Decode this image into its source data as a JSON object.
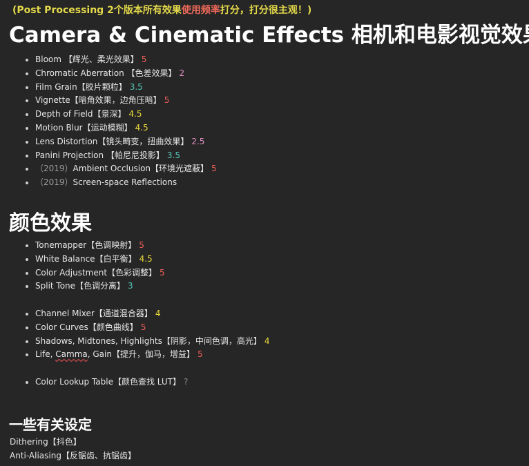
{
  "note": {
    "prefix": "(Post  Processing 2个版本所有效果",
    "highlight": "使用频率",
    "suffix": "打分，打分很主观！)"
  },
  "section1": {
    "title": "Camera & Cinematic Effects 相机和电影视觉效果",
    "items": [
      {
        "prefix": "",
        "text": "Bloom 【辉光、柔光效果】",
        "score": "5",
        "tone": "r"
      },
      {
        "prefix": "",
        "text": "Chromatic Aberration 【色差效果】",
        "score": "2",
        "tone": "p"
      },
      {
        "prefix": "",
        "text": "Film Grain【胶片颗粒】",
        "score": "3.5",
        "tone": "t"
      },
      {
        "prefix": "",
        "text": "Vignette【暗角效果，边角压暗】",
        "score": "5",
        "tone": "r"
      },
      {
        "prefix": "",
        "text": "Depth of Field【景深】",
        "score": "4.5",
        "tone": "y"
      },
      {
        "prefix": "",
        "text": "Motion Blur【运动模糊】",
        "score": "4.5",
        "tone": "y"
      },
      {
        "prefix": "",
        "text": "Lens Distortion【镜头畸变，扭曲效果】",
        "score": "2.5",
        "tone": "p"
      },
      {
        "prefix": "",
        "text": "Panini Projection 【帕尼尼投影】",
        "score": "3.5",
        "tone": "t"
      },
      {
        "prefix": "（2019）",
        "text": "Ambient Occlusion【环境光遮蔽】",
        "score": "5",
        "tone": "r"
      },
      {
        "prefix": "（2019）",
        "text": "Screen-space Reflections",
        "score": "",
        "tone": "r"
      }
    ]
  },
  "section2": {
    "title": "颜色效果",
    "items": [
      {
        "text": "Tonemapper【色调映射】",
        "score": "5",
        "tone": "r"
      },
      {
        "text": "White Balance【白平衡】",
        "score": "4.5",
        "tone": "y"
      },
      {
        "text": "Color Adjustment【色彩调整】",
        "score": "5",
        "tone": "r"
      },
      {
        "text": "Split Tone【色调分离】",
        "score": "3",
        "tone": "t"
      },
      {
        "text": "Channel Mixer【通道混合器】",
        "score": "4",
        "tone": "y"
      },
      {
        "text": "Color Curves【颜色曲线】",
        "score": "5",
        "tone": "r"
      },
      {
        "text": "Shadows, Midtones, Highlights【阴影，中间色调，高光】",
        "score": "4",
        "tone": "y"
      },
      {
        "text_a": "Life, ",
        "text_b": "Camma",
        "text_c": ", Gain【提升，伽马，增益】",
        "score": "5",
        "tone": "r"
      },
      {
        "text": "Color Lookup Table【颜色查找 LUT】",
        "score": "?",
        "tone": "q"
      }
    ]
  },
  "section3": {
    "title": "一些有关设定",
    "lines": [
      "Dithering【抖色】",
      "Anti-Aliasing【反锯齿、抗锯齿】"
    ]
  }
}
